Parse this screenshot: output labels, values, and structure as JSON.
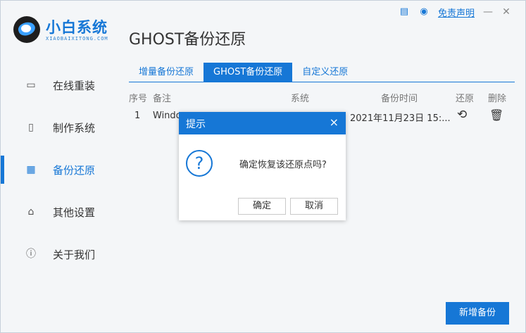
{
  "app": {
    "brand_name": "小白系统",
    "brand_sub": "XIAOBAIXITONG.COM",
    "page_title": "GHOST备份还原"
  },
  "topbar": {
    "disclaimer": "免责声明",
    "minimize": "—",
    "close": "✕"
  },
  "sidebar": {
    "items": [
      {
        "label": "在线重装",
        "icon": "monitor-icon",
        "glyph": "▭"
      },
      {
        "label": "制作系统",
        "icon": "usb-drive-icon",
        "glyph": "▯"
      },
      {
        "label": "备份还原",
        "icon": "backup-grid-icon",
        "glyph": "▦"
      },
      {
        "label": "其他设置",
        "icon": "briefcase-icon",
        "glyph": "⌂"
      },
      {
        "label": "关于我们",
        "icon": "info-icon",
        "glyph": "ⓘ"
      }
    ],
    "active_index": 2
  },
  "tabs": [
    {
      "label": "增量备份还原"
    },
    {
      "label": "GHOST备份还原"
    },
    {
      "label": "自定义还原"
    }
  ],
  "table": {
    "headers": {
      "index": "序号",
      "note": "备注",
      "system": "系统",
      "time": "备份时间",
      "restore": "还原",
      "delete": "删除"
    },
    "rows": [
      {
        "index": "1",
        "note": "Windo",
        "system": "",
        "time": "2021年11月23日 15:..."
      }
    ]
  },
  "buttons": {
    "add_backup": "新增备份"
  },
  "dialog": {
    "title": "提示",
    "close": "×",
    "icon_glyph": "?",
    "message": "确定恢复该还原点吗?",
    "confirm": "确定",
    "cancel": "取消"
  },
  "colors": {
    "accent": "#1677d6"
  }
}
